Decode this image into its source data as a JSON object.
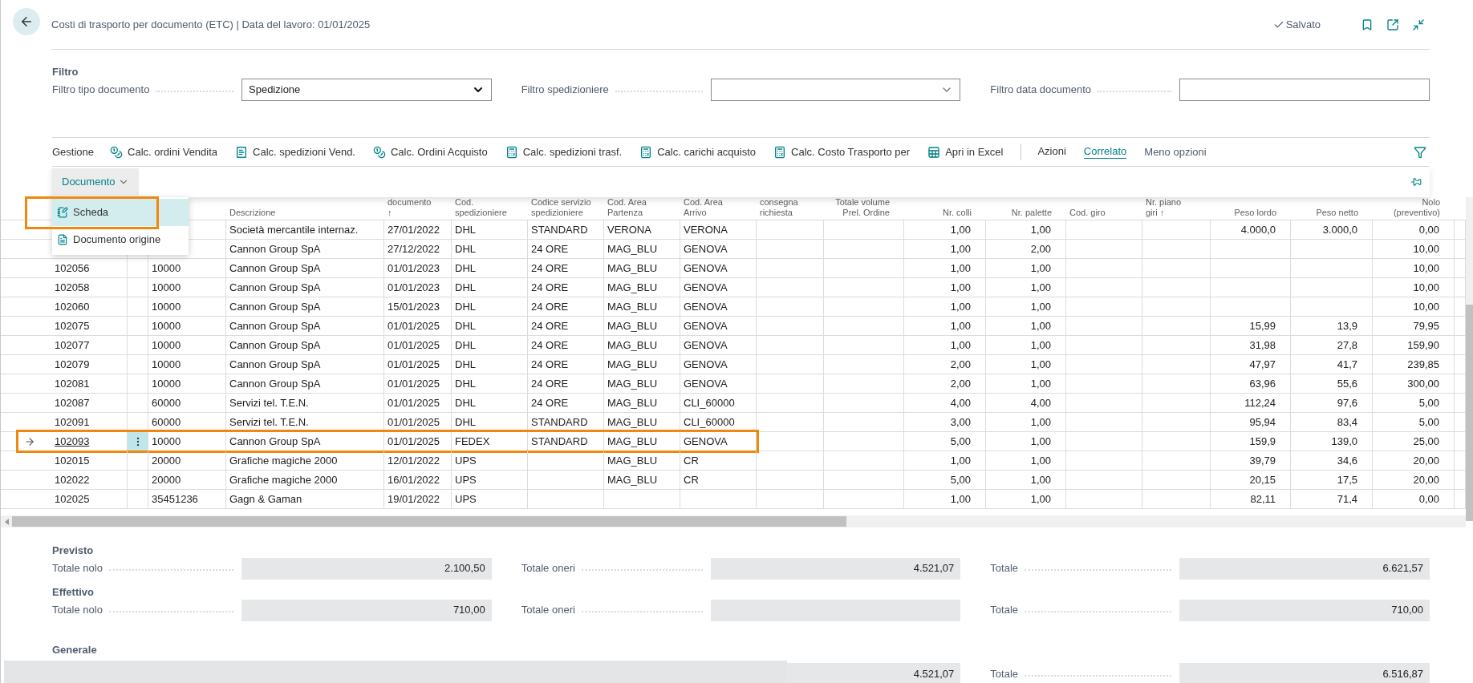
{
  "header": {
    "title": "Costi di trasporto per documento (ETC) | Data del lavoro: 01/01/2025",
    "status": "Salvato"
  },
  "filters": {
    "title": "Filtro",
    "fields": [
      {
        "label": "Filtro tipo documento",
        "kind": "select",
        "value": "Spedizione"
      },
      {
        "label": "Filtro spedizioniere",
        "kind": "select"
      },
      {
        "label": "Filtro data documento",
        "kind": "text"
      }
    ]
  },
  "action_bar": {
    "items": [
      {
        "label": "Gestione",
        "kind": "text"
      },
      {
        "label": "Calc. ordini Vendita",
        "kind": "coins"
      },
      {
        "label": "Calc. spedizioni Vend.",
        "kind": "receipt"
      },
      {
        "label": "Calc. Ordini Acquisto",
        "kind": "coins"
      },
      {
        "label": "Calc. spedizioni trasf.",
        "kind": "calculator"
      },
      {
        "label": "Calc. carichi acquisto",
        "kind": "calculator"
      },
      {
        "label": "Calc. Costo Trasporto per",
        "kind": "calculator"
      },
      {
        "label": "Apri in Excel",
        "kind": "excel"
      }
    ],
    "tabs": [
      {
        "label": "Azioni",
        "selected": false
      },
      {
        "label": "Correlato",
        "selected": true
      }
    ],
    "toggle": "Meno opzioni"
  },
  "sub_bar": {
    "menu_button": "Documento",
    "expanded": true
  },
  "menu": {
    "items": [
      {
        "label": "Scheda",
        "kind": "card",
        "selected": true,
        "highlighted": true
      },
      {
        "label": "Documento origine",
        "kind": "document",
        "selected": false,
        "highlighted": false
      }
    ]
  },
  "table": {
    "columns": [
      {
        "label": "Descrizione"
      },
      {
        "label": "documento\n↑"
      },
      {
        "label": "Cod.\nspedizioniere"
      },
      {
        "label": "Codice servizio\nspedizioniere"
      },
      {
        "label": "Cod. Area\nPartenza"
      },
      {
        "label": "Cod. Area\nArrivo"
      },
      {
        "label": "consegna\nrichiesta"
      },
      {
        "label": "Totale volume\nPrel. Ordine"
      },
      {
        "label": "Nr. colli"
      },
      {
        "label": "Nr. palette"
      },
      {
        "label": "Cod. giro"
      },
      {
        "label": "Nr. piano\ngiri ↑"
      },
      {
        "label": "Peso lordo"
      },
      {
        "label": "Peso netto"
      },
      {
        "label": "Nolo\n(preventivo)"
      }
    ],
    "rows": [
      {
        "selected": false,
        "description": "Società mercantile internaz.",
        "date": "27/01/2022",
        "carrier": "DHL",
        "service": "STANDARD",
        "from": "VERONA",
        "to": "VERONA",
        "packages": "1,00",
        "pallets": "1,00",
        "gross": "4.000,0",
        "net": "3.000,0",
        "freight": "0,00"
      },
      {
        "selected": false,
        "description": "Cannon Group SpA",
        "date": "27/12/2022",
        "carrier": "DHL",
        "service": "24 ORE",
        "from": "MAG_BLU",
        "to": "GENOVA",
        "packages": "1,00",
        "pallets": "2,00",
        "freight": "10,00"
      },
      {
        "selected": false,
        "no": "102056",
        "customer": "10000",
        "description": "Cannon Group SpA",
        "date": "01/01/2023",
        "carrier": "DHL",
        "service": "24 ORE",
        "from": "MAG_BLU",
        "to": "GENOVA",
        "packages": "1,00",
        "pallets": "1,00",
        "freight": "10,00"
      },
      {
        "selected": false,
        "no": "102058",
        "customer": "10000",
        "description": "Cannon Group SpA",
        "date": "01/01/2023",
        "carrier": "DHL",
        "service": "24 ORE",
        "from": "MAG_BLU",
        "to": "GENOVA",
        "packages": "1,00",
        "pallets": "1,00",
        "freight": "10,00"
      },
      {
        "selected": false,
        "no": "102060",
        "customer": "10000",
        "description": "Cannon Group SpA",
        "date": "15/01/2023",
        "carrier": "DHL",
        "service": "24 ORE",
        "from": "MAG_BLU",
        "to": "GENOVA",
        "packages": "1,00",
        "pallets": "1,00",
        "freight": "10,00"
      },
      {
        "selected": false,
        "no": "102075",
        "customer": "10000",
        "description": "Cannon Group SpA",
        "date": "01/01/2025",
        "carrier": "DHL",
        "service": "24 ORE",
        "from": "MAG_BLU",
        "to": "GENOVA",
        "packages": "1,00",
        "pallets": "1,00",
        "gross": "15,99",
        "net": "13,9",
        "freight": "79,95"
      },
      {
        "selected": false,
        "no": "102077",
        "customer": "10000",
        "description": "Cannon Group SpA",
        "date": "01/01/2025",
        "carrier": "DHL",
        "service": "24 ORE",
        "from": "MAG_BLU",
        "to": "GENOVA",
        "packages": "1,00",
        "pallets": "1,00",
        "gross": "31,98",
        "net": "27,8",
        "freight": "159,90"
      },
      {
        "selected": false,
        "no": "102079",
        "customer": "10000",
        "description": "Cannon Group SpA",
        "date": "01/01/2025",
        "carrier": "DHL",
        "service": "24 ORE",
        "from": "MAG_BLU",
        "to": "GENOVA",
        "packages": "2,00",
        "pallets": "1,00",
        "gross": "47,97",
        "net": "41,7",
        "freight": "239,85"
      },
      {
        "selected": false,
        "no": "102081",
        "customer": "10000",
        "description": "Cannon Group SpA",
        "date": "01/01/2025",
        "carrier": "DHL",
        "service": "24 ORE",
        "from": "MAG_BLU",
        "to": "GENOVA",
        "packages": "2,00",
        "pallets": "1,00",
        "gross": "63,96",
        "net": "55,6",
        "freight": "300,00"
      },
      {
        "selected": false,
        "no": "102087",
        "customer": "60000",
        "description": "Servizi tel. T.E.N.",
        "date": "01/01/2025",
        "carrier": "DHL",
        "service": "24 ORE",
        "from": "MAG_BLU",
        "to": "CLI_60000",
        "packages": "4,00",
        "pallets": "4,00",
        "gross": "112,24",
        "net": "97,6",
        "freight": "5,00"
      },
      {
        "selected": false,
        "no": "102091",
        "customer": "60000",
        "description": "Servizi tel. T.E.N.",
        "date": "01/01/2025",
        "carrier": "DHL",
        "service": "STANDARD",
        "from": "MAG_BLU",
        "to": "CLI_60000",
        "packages": "3,00",
        "pallets": "1,00",
        "gross": "95,94",
        "net": "83,4",
        "freight": "5,00"
      },
      {
        "selected": true,
        "no": "102093",
        "customer": "10000",
        "description": "Cannon Group SpA",
        "date": "01/01/2025",
        "carrier": "FEDEX",
        "service": "STANDARD",
        "from": "MAG_BLU",
        "to": "GENOVA",
        "packages": "5,00",
        "pallets": "1,00",
        "gross": "159,9",
        "net": "139,0",
        "freight": "25,00"
      },
      {
        "selected": false,
        "no": "102015",
        "customer": "20000",
        "description": "Grafiche magiche 2000",
        "date": "12/01/2022",
        "carrier": "UPS",
        "from": "MAG_BLU",
        "to": "CR",
        "packages": "1,00",
        "pallets": "1,00",
        "gross": "39,79",
        "net": "34,6",
        "freight": "20,00"
      },
      {
        "selected": false,
        "no": "102022",
        "customer": "20000",
        "description": "Grafiche magiche 2000",
        "date": "16/01/2022",
        "carrier": "UPS",
        "from": "MAG_BLU",
        "to": "CR",
        "packages": "5,00",
        "pallets": "1,00",
        "gross": "20,15",
        "net": "17,5",
        "freight": "20,00"
      },
      {
        "selected": false,
        "no": "102025",
        "customer": "35451236",
        "description": "Gagn & Gaman",
        "date": "19/01/2022",
        "carrier": "UPS",
        "packages": "1,00",
        "pallets": "1,00",
        "gross": "82,11",
        "net": "71,4",
        "freight": "0,00"
      }
    ]
  },
  "summary": {
    "sections": [
      {
        "title": "Previsto",
        "fields": [
          {
            "label": "Totale nolo",
            "value": "2.100,50"
          },
          {
            "label": "Totale oneri",
            "value": "4.521,07"
          },
          {
            "label": "Totale",
            "value": "6.621,57"
          }
        ]
      },
      {
        "title": "Effettivo",
        "fields": [
          {
            "label": "Totale nolo",
            "value": "710,00"
          },
          {
            "label": "Totale oneri"
          },
          {
            "label": "Totale",
            "value": "710,00"
          }
        ]
      },
      {
        "title": "Generale",
        "covered": true,
        "fields": [
          {
            "value": "4.521,07"
          },
          {
            "label": "Totale",
            "value": "6.516,87"
          }
        ]
      }
    ]
  }
}
